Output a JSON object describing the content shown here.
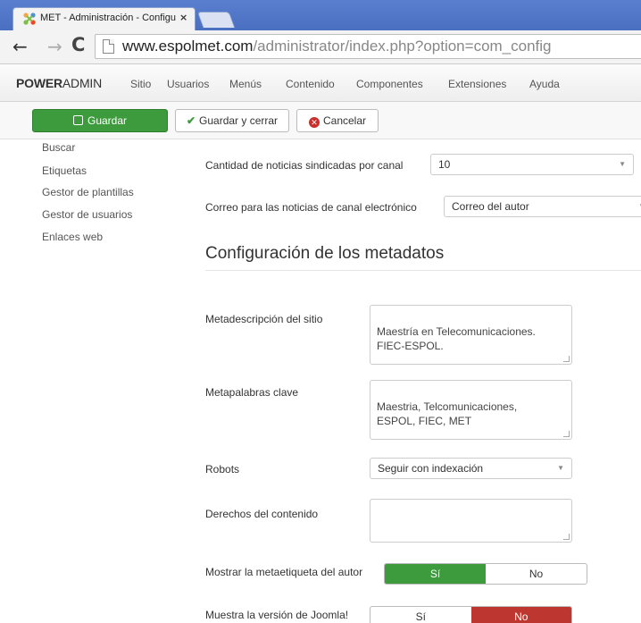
{
  "browser": {
    "tab_title": "MET - Administración - Configuración",
    "tab_close": "×",
    "url_domain": "www.espolmet.com",
    "url_path": "/administrator/index.php?option=com_config"
  },
  "topmenu": {
    "brand_bold": "POWER",
    "brand_rest": "ADMIN",
    "items": [
      "Sitio",
      "Usuarios",
      "Menús",
      "Contenido",
      "Componentes",
      "Extensiones",
      "Ayuda"
    ]
  },
  "toolbar": {
    "save_label": "Guardar",
    "save_close_label": "Guardar y cerrar",
    "cancel_label": "Cancelar"
  },
  "sidebar": {
    "items": [
      "Buscar",
      "Etiquetas",
      "Gestor de plantillas",
      "Gestor de usuarios",
      "Enlaces web"
    ]
  },
  "form": {
    "feed_count_label": "Cantidad de noticias sindicadas por canal",
    "feed_count_value": "10",
    "feed_email_label": "Correo para las noticias de canal electrónico",
    "feed_email_value": "Correo del autor",
    "metadata_title": "Configuración de los metadatos",
    "meta_desc_label": "Metadescripción del sitio",
    "meta_desc_value": "Maestría en Telecomunicaciones.\nFIEC-ESPOL.",
    "meta_keywords_label": "Metapalabras clave",
    "meta_keywords_value": "Maestria, Telcomunicaciones,\nESPOL, FIEC, MET",
    "robots_label": "Robots",
    "robots_value": "Seguir con indexación",
    "rights_label": "Derechos del contenido",
    "rights_value": "",
    "author_label": "Mostrar la metaetiqueta del autor",
    "version_label": "Muestra la versión de Joomla!",
    "yes": "Sí",
    "no": "No"
  },
  "colors": {
    "accent_green": "#3d9b3d",
    "accent_red": "#bd362f",
    "browser_blue": "#4a6fc1"
  }
}
